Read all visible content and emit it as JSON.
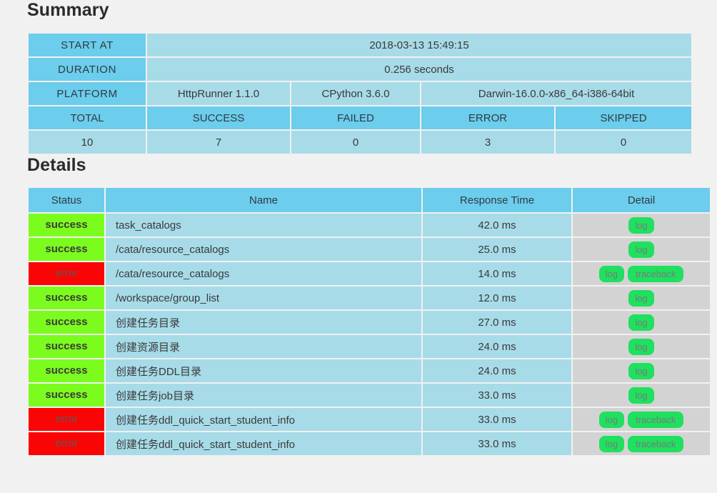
{
  "page": {
    "background_color": "#f1f1f1",
    "header_cell_color": "#6ccdec",
    "body_cell_color": "#a7dbe8",
    "success_color": "#7cfc1e",
    "error_color": "#fa0505",
    "detail_cell_color": "#d3d3d3",
    "chip_color": "#1fe05f"
  },
  "summary": {
    "title": "Summary",
    "rows": [
      {
        "label": "START AT",
        "value": "2018-03-13 15:49:15"
      },
      {
        "label": "DURATION",
        "value": "0.256 seconds"
      }
    ],
    "platform": {
      "label": "PLATFORM",
      "httprunner": "HttpRunner 1.1.0",
      "python": "CPython 3.6.0",
      "os": "Darwin-16.0.0-x86_64-i386-64bit"
    },
    "stats_headers": [
      "TOTAL",
      "SUCCESS",
      "FAILED",
      "ERROR",
      "SKIPPED"
    ],
    "stats_values": [
      "10",
      "7",
      "0",
      "3",
      "0"
    ]
  },
  "details": {
    "title": "Details",
    "headers": [
      "Status",
      "Name",
      "Response Time",
      "Detail"
    ],
    "chip_log": "log",
    "chip_traceback": "traceback",
    "rows": [
      {
        "status": "success",
        "name": "task_catalogs",
        "time": "42.0 ms",
        "chips": [
          "log"
        ]
      },
      {
        "status": "success",
        "name": "/cata/resource_catalogs",
        "time": "25.0 ms",
        "chips": [
          "log"
        ]
      },
      {
        "status": "error",
        "name": "/cata/resource_catalogs",
        "time": "14.0 ms",
        "chips": [
          "log",
          "traceback"
        ]
      },
      {
        "status": "success",
        "name": "/workspace/group_list",
        "time": "12.0 ms",
        "chips": [
          "log"
        ]
      },
      {
        "status": "success",
        "name": "创建任务目录",
        "time": "27.0 ms",
        "chips": [
          "log"
        ]
      },
      {
        "status": "success",
        "name": "创建资源目录",
        "time": "24.0 ms",
        "chips": [
          "log"
        ]
      },
      {
        "status": "success",
        "name": "创建任务DDL目录",
        "time": "24.0 ms",
        "chips": [
          "log"
        ]
      },
      {
        "status": "success",
        "name": "创建任务job目录",
        "time": "33.0 ms",
        "chips": [
          "log"
        ]
      },
      {
        "status": "error",
        "name": "创建任务ddl_quick_start_student_info",
        "time": "33.0 ms",
        "chips": [
          "log",
          "traceback"
        ]
      },
      {
        "status": "error",
        "name": "创建任务ddl_quick_start_student_info",
        "time": "33.0 ms",
        "chips": [
          "log",
          "traceback"
        ]
      }
    ]
  }
}
